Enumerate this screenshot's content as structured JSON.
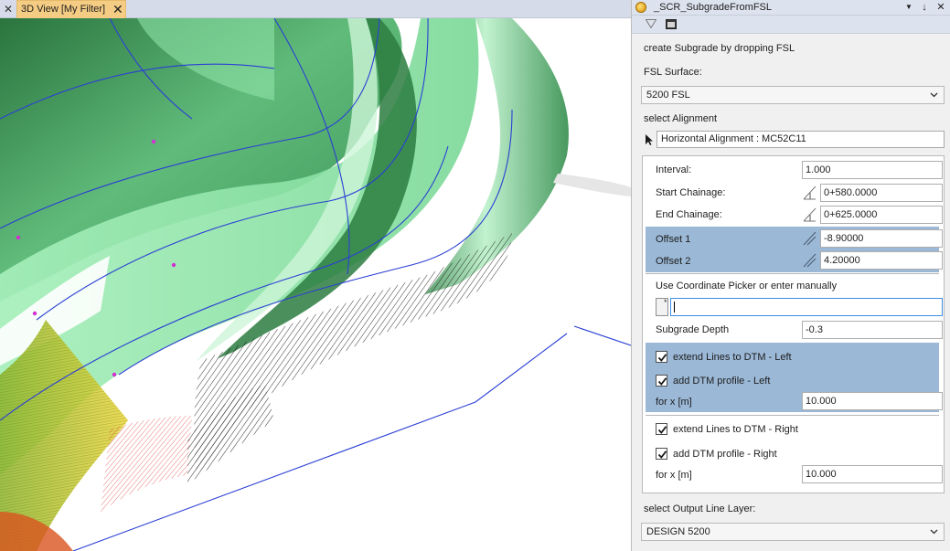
{
  "viewport": {
    "tab_label": "3D View [My Filter]",
    "tab_close_glyph": "✕",
    "tab_pin_glyph": "✕"
  },
  "panel": {
    "title": "_SCR_SubgradeFromFSL",
    "menu_glyph": "▼",
    "pin_glyph": "↓",
    "close_glyph": "✕",
    "heading": "create Subgrade by dropping FSL",
    "fsl_surface": {
      "label": "FSL Surface:",
      "value": "5200 FSL"
    },
    "alignment": {
      "label": "select Alignment",
      "value": "Horizontal Alignment : MC52C11"
    },
    "interval": {
      "label": "Interval:",
      "value": "1.000"
    },
    "start_chainage": {
      "label": "Start Chainage:",
      "value": "0+580.0000"
    },
    "end_chainage": {
      "label": "End Chainage:",
      "value": "0+625.0000"
    },
    "offset1": {
      "label": "Offset 1",
      "value": "-8.90000"
    },
    "offset2": {
      "label": "Offset 2",
      "value": "4.20000"
    },
    "coordinate": {
      "label": "Use Coordinate Picker or enter manually",
      "value": ""
    },
    "subgrade_depth": {
      "label": "Subgrade Depth",
      "value": "-0.3"
    },
    "left": {
      "extend_label": "extend Lines to DTM - Left",
      "extend_checked": true,
      "profile_label": "add DTM profile - Left",
      "profile_checked": true,
      "for_x_label": "for x [m]",
      "for_x_value": "10.000"
    },
    "right": {
      "extend_label": "extend Lines to DTM - Right",
      "extend_checked": true,
      "profile_label": "add DTM profile - Right",
      "profile_checked": true,
      "for_x_label": "for x [m]",
      "for_x_value": "10.000"
    },
    "output_layer": {
      "label": "select Output Line Layer:",
      "value": "DESIGN 5200"
    }
  },
  "icons": [
    "close-icon",
    "filter-icon",
    "window-icon",
    "pointer-arrow-icon",
    "chainage-picker-icon",
    "coordinate-picker-icon",
    "checkmark-icon",
    "chevron-down-icon"
  ],
  "colors": {
    "tab_active": "#f5cc84",
    "band_blue": "#9bb8d6",
    "surface_green": "#8fe3a8",
    "surface_dark_green": "#2f7f43",
    "line_blue": "#2a3fd4"
  }
}
